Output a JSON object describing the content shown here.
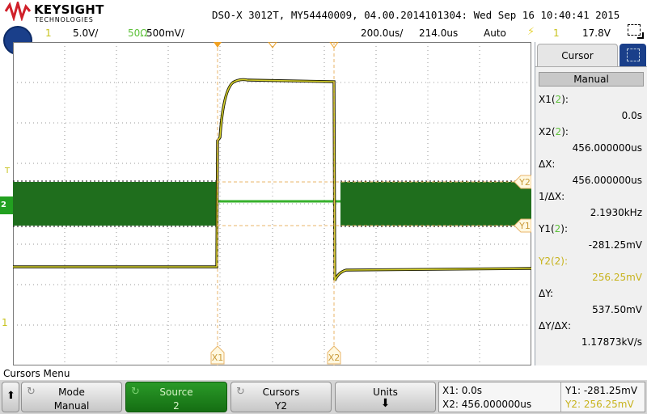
{
  "header": {
    "brand": "KEYSIGHT",
    "brand_sub": "TECHNOLOGIES",
    "title": "DSO-X 3012T, MY54440009, 04.00.2014101304: Wed Sep 16 10:40:41 2015",
    "ch1_number": "1",
    "ch1_scale": "5.0V/",
    "ch2_impedance": "50Ω",
    "ch2_scale": "500mV/",
    "timebase": "200.0us/",
    "delay": "214.0us",
    "trigger_mode": "Auto",
    "trigger_source": "1",
    "trigger_level": "17.8V"
  },
  "side_panel": {
    "tab_label": "Cursor",
    "mode_value": "Manual",
    "rows": [
      {
        "label": "X1(",
        "src": "2",
        "tail": "):",
        "value": "0.0s"
      },
      {
        "label": "X2(",
        "src": "2",
        "tail": "):",
        "value": "456.000000us"
      },
      {
        "label": "ΔX:",
        "value": "456.000000us"
      },
      {
        "label": "1/ΔX:",
        "value": "2.1930kHz"
      },
      {
        "label": "Y1(",
        "src": "2",
        "tail": "):",
        "value": "-281.25mV"
      },
      {
        "label": "Y2(",
        "src": "2",
        "tail": "):",
        "value": "256.25mV"
      },
      {
        "label": "ΔY:",
        "value": "537.50mV"
      },
      {
        "label": "ΔY/ΔX:",
        "value": "1.17873kV/s"
      }
    ]
  },
  "screen": {
    "markers": {
      "x1": "X1",
      "x2": "X2",
      "y1": "Y1",
      "y2": "Y2",
      "ch2_ground": "2",
      "ch1_ground": "1",
      "trigger_t": "T"
    }
  },
  "menu": {
    "title": "Cursors Menu",
    "softkeys": [
      {
        "label": "Mode",
        "value": "Manual"
      },
      {
        "label": "Source",
        "value": "2"
      },
      {
        "label": "Cursors",
        "value": "Y2"
      },
      {
        "label": "Units",
        "value": ""
      }
    ],
    "readout": {
      "x1": "X1:  0.0s",
      "x2": "X2:  456.000000us",
      "y1": "Y1: -281.25mV",
      "y2": "Y2: 256.25mV"
    }
  },
  "colors": {
    "ch1": "#c7c21b",
    "ch2": "#22a020",
    "cursor": "#e8b56a",
    "grid": "#9a9a9a"
  }
}
